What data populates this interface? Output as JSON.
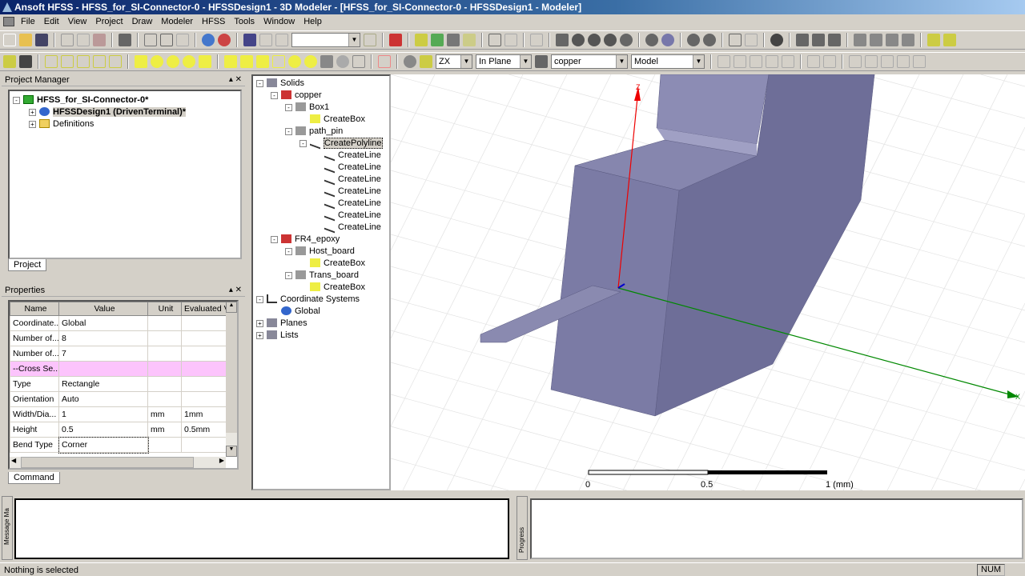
{
  "title": "Ansoft HFSS - HFSS_for_SI-Connector-0 - HFSSDesign1 - 3D Modeler - [HFSS_for_SI-Connector-0 - HFSSDesign1 - Modeler]",
  "menu": [
    "File",
    "Edit",
    "View",
    "Project",
    "Draw",
    "Modeler",
    "HFSS",
    "Tools",
    "Window",
    "Help"
  ],
  "toolbar2": {
    "plane": "ZX",
    "movement": "In Plane",
    "material": "copper",
    "mode": "Model"
  },
  "project_manager": {
    "title": "Project Manager",
    "project": "HFSS_for_SI-Connector-0*",
    "design": "HFSSDesign1 (DrivenTerminal)*",
    "definitions": "Definitions",
    "tab": "Project"
  },
  "tree": [
    {
      "label": "Solids",
      "level": 0,
      "exp": "-",
      "icon": "solids"
    },
    {
      "label": "copper",
      "level": 1,
      "exp": "-",
      "icon": "material"
    },
    {
      "label": "Box1",
      "level": 2,
      "exp": "-",
      "icon": "object"
    },
    {
      "label": "CreateBox",
      "level": 3,
      "exp": "",
      "icon": "command"
    },
    {
      "label": "path_pin",
      "level": 2,
      "exp": "-",
      "icon": "object"
    },
    {
      "label": "CreatePolyline",
      "level": 3,
      "exp": "-",
      "icon": "polyline",
      "selected": true
    },
    {
      "label": "CreateLine",
      "level": 4,
      "exp": "",
      "icon": "line"
    },
    {
      "label": "CreateLine",
      "level": 4,
      "exp": "",
      "icon": "line"
    },
    {
      "label": "CreateLine",
      "level": 4,
      "exp": "",
      "icon": "line"
    },
    {
      "label": "CreateLine",
      "level": 4,
      "exp": "",
      "icon": "line"
    },
    {
      "label": "CreateLine",
      "level": 4,
      "exp": "",
      "icon": "line"
    },
    {
      "label": "CreateLine",
      "level": 4,
      "exp": "",
      "icon": "line"
    },
    {
      "label": "CreateLine",
      "level": 4,
      "exp": "",
      "icon": "line"
    },
    {
      "label": "FR4_epoxy",
      "level": 1,
      "exp": "-",
      "icon": "material"
    },
    {
      "label": "Host_board",
      "level": 2,
      "exp": "-",
      "icon": "object"
    },
    {
      "label": "CreateBox",
      "level": 3,
      "exp": "",
      "icon": "command"
    },
    {
      "label": "Trans_board",
      "level": 2,
      "exp": "-",
      "icon": "object"
    },
    {
      "label": "CreateBox",
      "level": 3,
      "exp": "",
      "icon": "command"
    },
    {
      "label": "Coordinate Systems",
      "level": 0,
      "exp": "-",
      "icon": "coords"
    },
    {
      "label": "Global",
      "level": 1,
      "exp": "",
      "icon": "globe"
    },
    {
      "label": "Planes",
      "level": 0,
      "exp": "+",
      "icon": "solids"
    },
    {
      "label": "Lists",
      "level": 0,
      "exp": "+",
      "icon": "solids"
    }
  ],
  "properties": {
    "title": "Properties",
    "columns": [
      "Name",
      "Value",
      "Unit",
      "Evaluated V"
    ],
    "rows": [
      [
        "Coordinate...",
        "Global",
        "",
        ""
      ],
      [
        "Number of...",
        "8",
        "",
        ""
      ],
      [
        "Number of...",
        "7",
        "",
        ""
      ],
      [
        "--Cross Se...",
        "",
        "",
        ""
      ],
      [
        "Type",
        "Rectangle",
        "",
        ""
      ],
      [
        "Orientation",
        "Auto",
        "",
        ""
      ],
      [
        "Width/Dia...",
        "1",
        "mm",
        "1mm"
      ],
      [
        "Height",
        "0.5",
        "mm",
        "0.5mm"
      ],
      [
        "Bend Type",
        "Corner",
        "",
        ""
      ]
    ],
    "tab": "Command"
  },
  "viewport": {
    "axis_z": "Z",
    "axis_x": "X",
    "scale": [
      "0",
      "0.5",
      "1 (mm)"
    ]
  },
  "messages": {
    "label": "Message Ma",
    "progress_label": "Progress"
  },
  "status": {
    "text": "Nothing is selected",
    "num": "NUM"
  }
}
